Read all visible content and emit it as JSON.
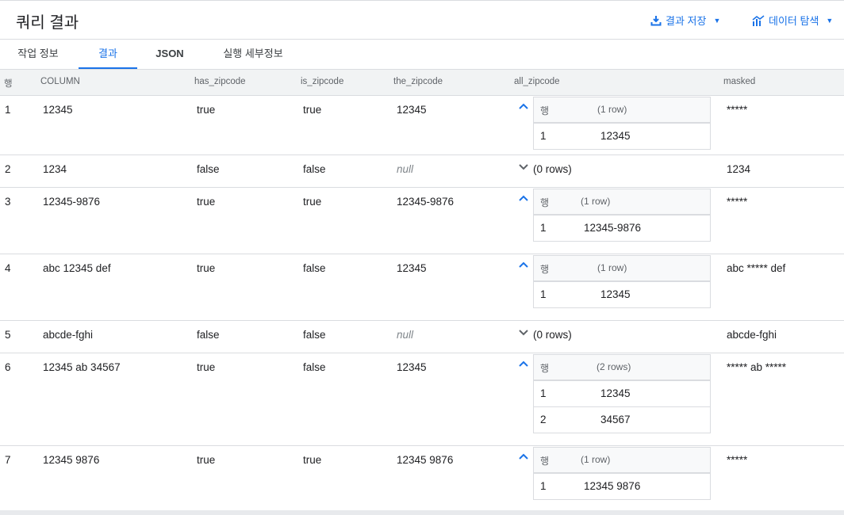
{
  "header": {
    "title": "쿼리 결과",
    "save_label": "결과 저장",
    "explore_label": "데이터 탐색",
    "accent": "#1a73e8"
  },
  "tabs": [
    {
      "label": "작업 정보"
    },
    {
      "label": "결과"
    },
    {
      "label": "JSON"
    },
    {
      "label": "실행 세부정보"
    }
  ],
  "columns": {
    "row": "행",
    "column": "COLUMN",
    "has_zipcode": "has_zipcode",
    "is_zipcode": "is_zipcode",
    "the_zipcode": "the_zipcode",
    "all_zipcode": "all_zipcode",
    "masked": "masked"
  },
  "nested_header": "행",
  "rows": [
    {
      "num": "1",
      "column": "12345",
      "has": "true",
      "is": "true",
      "the": "12345",
      "count": "(1 row)",
      "sub": [
        {
          "n": "1",
          "v": "12345"
        }
      ],
      "masked": "*****"
    },
    {
      "num": "2",
      "column": "1234",
      "has": "false",
      "is": "false",
      "the": "null",
      "count": "(0 rows)",
      "sub": [],
      "masked": "1234"
    },
    {
      "num": "3",
      "column": "12345-9876",
      "has": "true",
      "is": "true",
      "the": "12345-9876",
      "count": "(1 row)",
      "sub": [
        {
          "n": "1",
          "v": "12345-9876"
        }
      ],
      "masked": "*****"
    },
    {
      "num": "4",
      "column": "abc 12345 def",
      "has": "true",
      "is": "false",
      "the": "12345",
      "count": "(1 row)",
      "sub": [
        {
          "n": "1",
          "v": "12345"
        }
      ],
      "masked": "abc ***** def"
    },
    {
      "num": "5",
      "column": "abcde-fghi",
      "has": "false",
      "is": "false",
      "the": "null",
      "count": "(0 rows)",
      "sub": [],
      "masked": "abcde-fghi"
    },
    {
      "num": "6",
      "column": "12345 ab 34567",
      "has": "true",
      "is": "false",
      "the": "12345",
      "count": "(2 rows)",
      "sub": [
        {
          "n": "1",
          "v": "12345"
        },
        {
          "n": "2",
          "v": "34567"
        }
      ],
      "masked": "***** ab *****"
    },
    {
      "num": "7",
      "column": "12345 9876",
      "has": "true",
      "is": "true",
      "the": "12345 9876",
      "count": "(1 row)",
      "sub": [
        {
          "n": "1",
          "v": "12345 9876"
        }
      ],
      "masked": "*****"
    }
  ]
}
